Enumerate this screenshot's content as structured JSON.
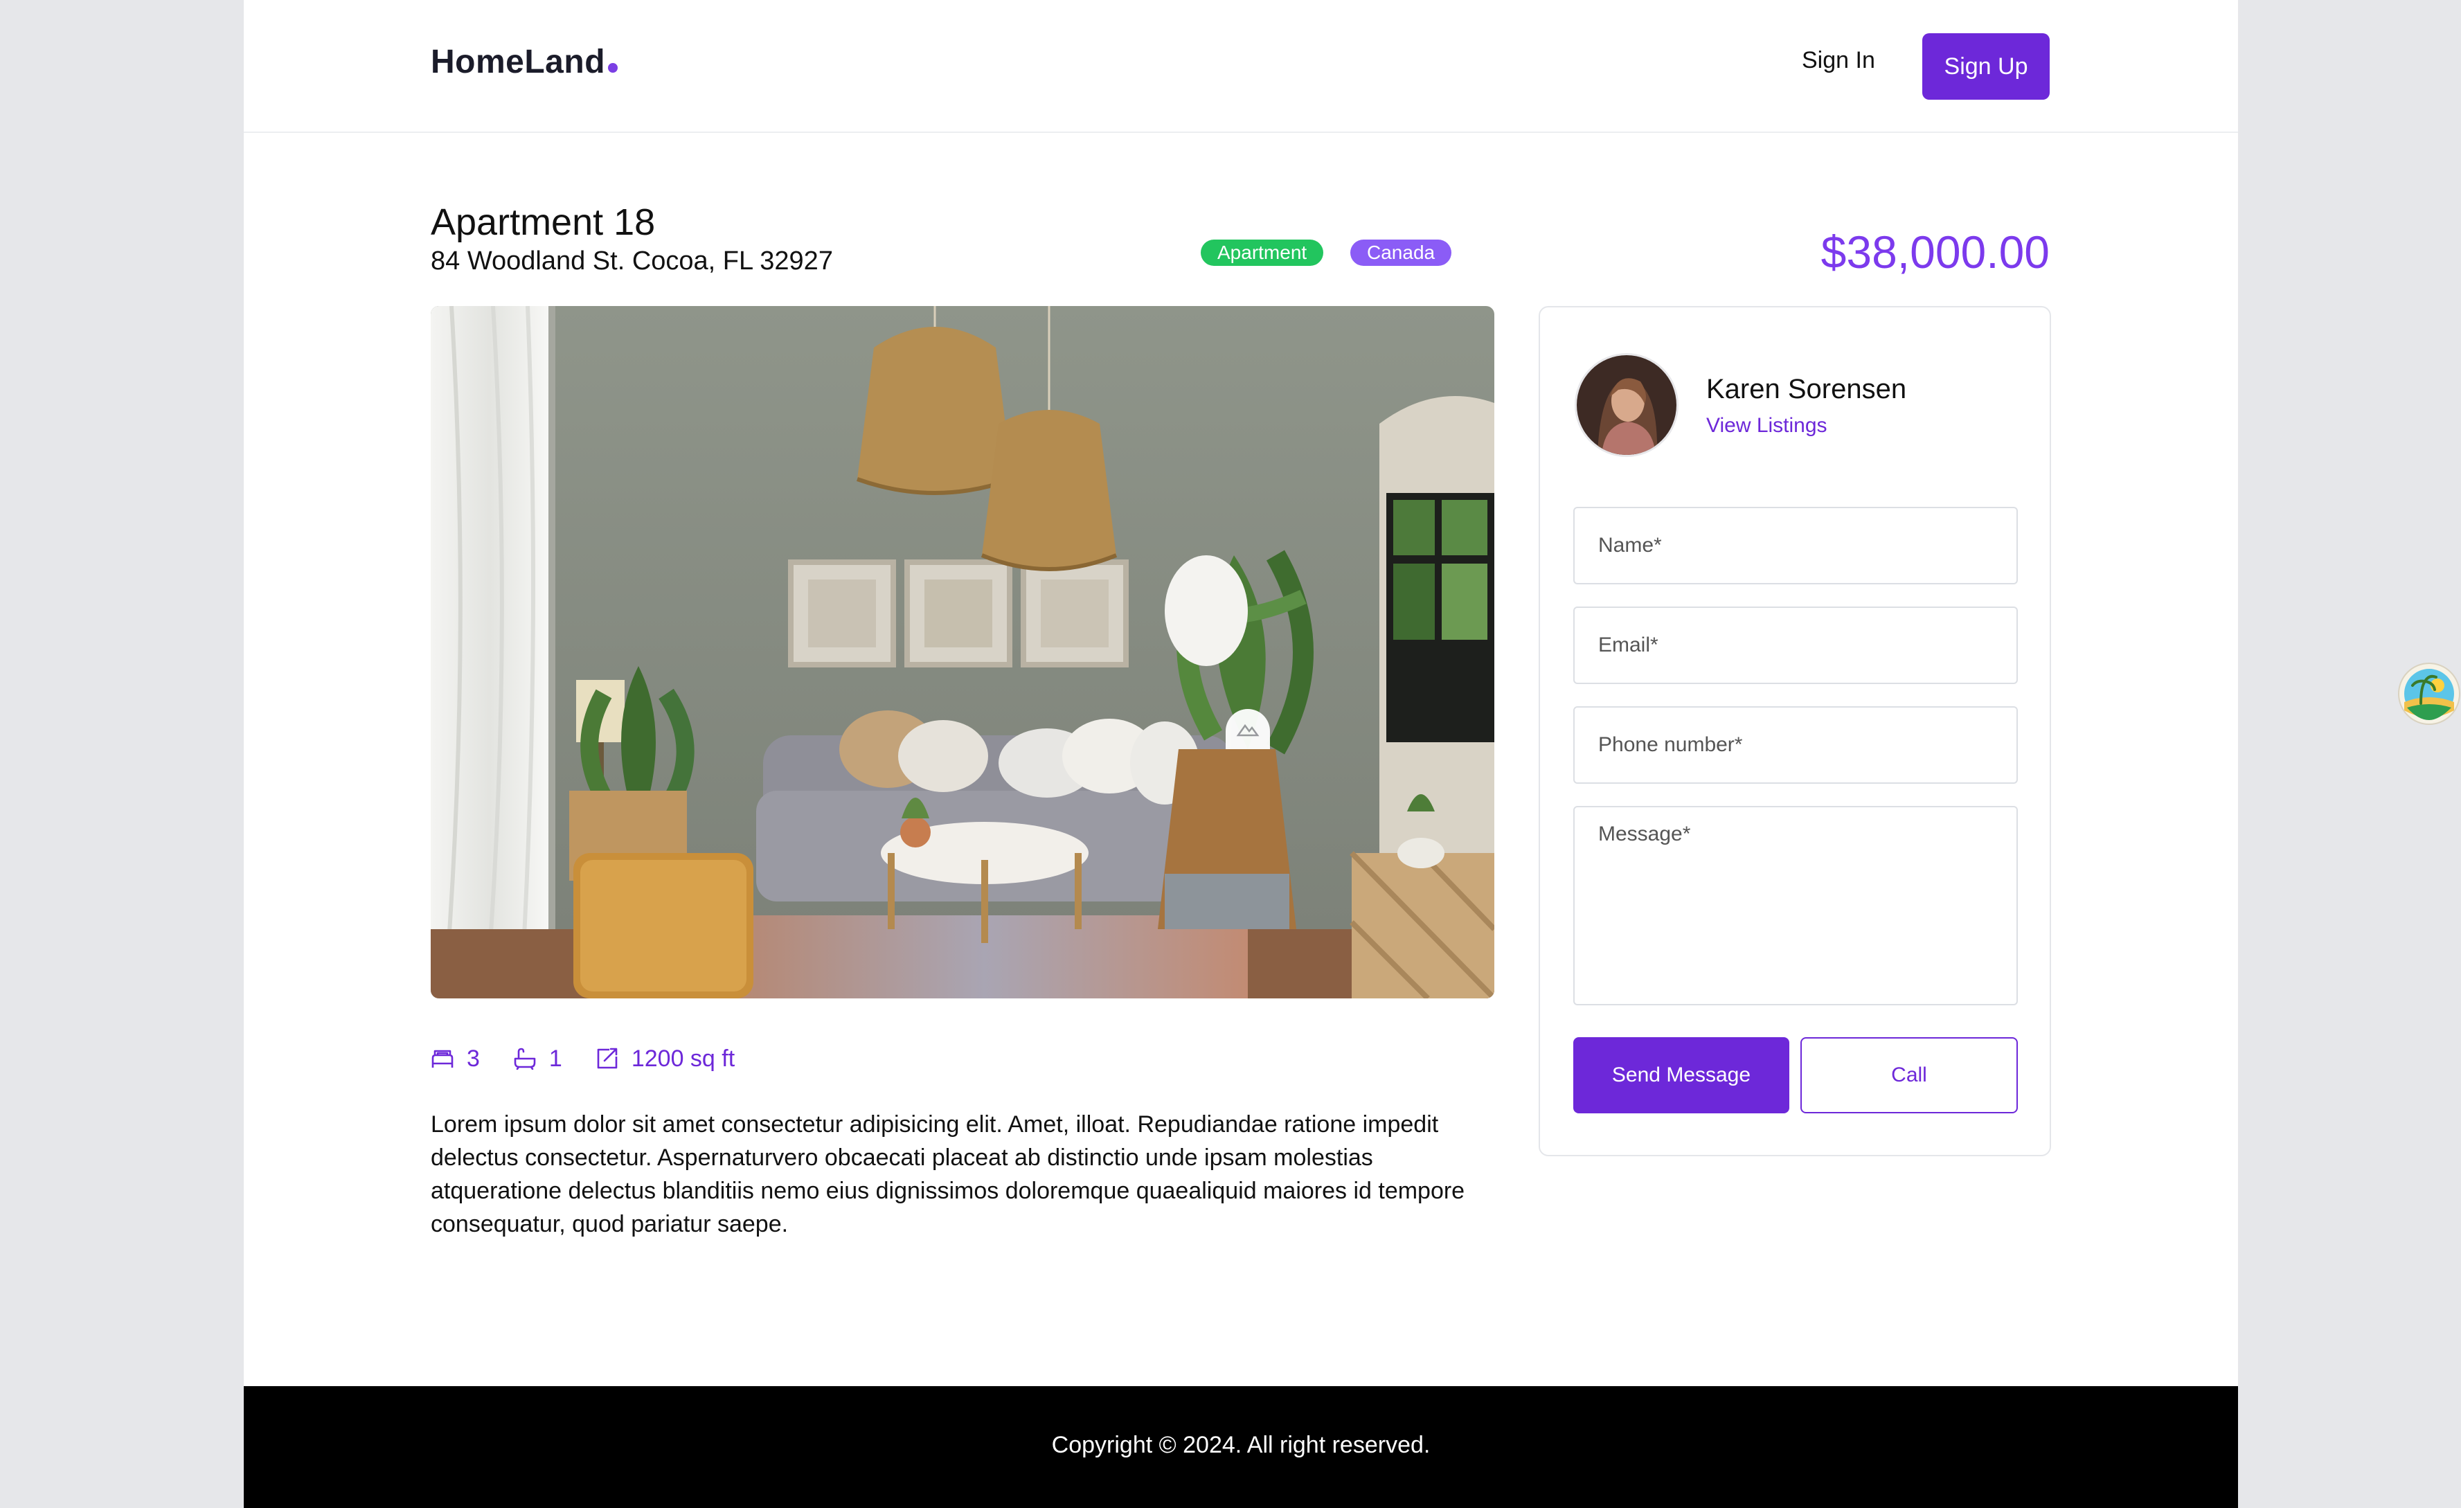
{
  "header": {
    "logo": "HomeLand",
    "sign_in": "Sign In",
    "sign_up": "Sign Up"
  },
  "listing": {
    "title": "Apartment 18",
    "address": "84 Woodland St. Cocoa, FL 32927",
    "tags": [
      "Apartment",
      "Canada"
    ],
    "price": "$38,000.00",
    "features": {
      "beds": "3",
      "baths": "1",
      "area": "1200 sq ft"
    },
    "description": "Lorem ipsum dolor sit amet consectetur adipisicing elit. Amet, illoat. Repudiandae ratione impedit delectus consectetur. Aspernaturvero obcaecati placeat ab distinctio unde ipsam molestias atqueratione delectus blanditiis nemo eius dignissimos doloremque quaealiquid maiores id tempore consequatur, quod pariatur saepe."
  },
  "agent": {
    "name": "Karen Sorensen",
    "link": "View Listings"
  },
  "form": {
    "name_placeholder": "Name*",
    "email_placeholder": "Email*",
    "phone_placeholder": "Phone number*",
    "message_placeholder": "Message*",
    "send_label": "Send Message",
    "call_label": "Call"
  },
  "footer": {
    "copyright": "Copyright © 2024. All right reserved."
  },
  "colors": {
    "accent": "#6d28d9",
    "price": "#7c3aed",
    "tag_apartment": "#22c55e",
    "tag_country": "#8b5cf6",
    "footer_bg": "#000000"
  }
}
